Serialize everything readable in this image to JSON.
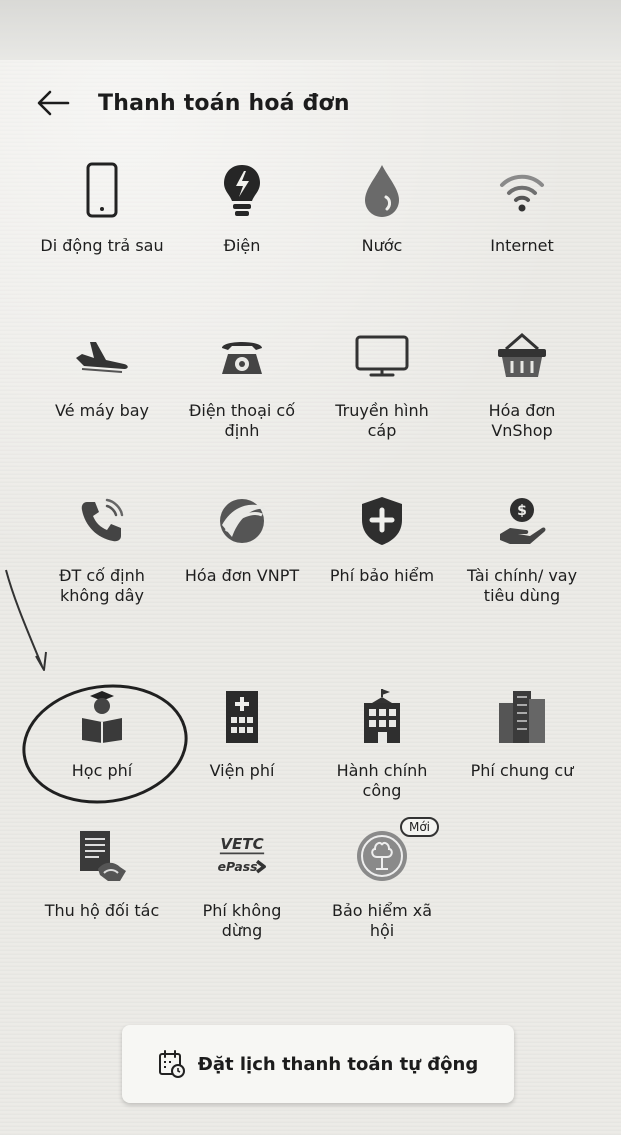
{
  "header": {
    "title": "Thanh toán hoá đơn",
    "back_icon": "arrow-left-icon"
  },
  "services": [
    {
      "id": "di-dong-tra-sau",
      "label": "Di động trả sau",
      "icon": "mobile-phone-icon"
    },
    {
      "id": "dien",
      "label": "Điện",
      "icon": "lightbulb-icon"
    },
    {
      "id": "nuoc",
      "label": "Nước",
      "icon": "water-drop-icon"
    },
    {
      "id": "internet",
      "label": "Internet",
      "icon": "wifi-icon"
    },
    {
      "id": "ve-may-bay",
      "label": "Vé máy bay",
      "icon": "airplane-icon"
    },
    {
      "id": "dien-thoai-co-dinh",
      "label": "Điện thoại cố định",
      "icon": "landline-phone-icon"
    },
    {
      "id": "truyen-hinh-cap",
      "label": "Truyền hình cáp",
      "icon": "tv-icon"
    },
    {
      "id": "hoa-don-vnshop",
      "label": "Hóa đơn VnShop",
      "icon": "shopping-basket-icon"
    },
    {
      "id": "dt-co-dinh-khong-day",
      "label": "ĐT cố định không dây",
      "icon": "phone-wireless-icon"
    },
    {
      "id": "hoa-don-vnpt",
      "label": "Hóa đơn VNPT",
      "icon": "vnpt-logo-icon"
    },
    {
      "id": "phi-bao-hiem",
      "label": "Phí bảo hiểm",
      "icon": "shield-plus-icon"
    },
    {
      "id": "tai-chinh-vay-tieu-dung",
      "label": "Tài chính/ vay tiêu dùng",
      "icon": "hand-coin-icon"
    },
    {
      "id": "hoc-phi",
      "label": "Học phí",
      "icon": "student-book-icon"
    },
    {
      "id": "vien-phi",
      "label": "Viện phí",
      "icon": "hospital-icon"
    },
    {
      "id": "hanh-chinh-cong",
      "label": "Hành chính công",
      "icon": "government-building-icon"
    },
    {
      "id": "phi-chung-cu",
      "label": "Phí chung cư",
      "icon": "apartment-icon"
    },
    {
      "id": "thu-ho-doi-tac",
      "label": "Thu hộ đối tác",
      "icon": "partner-collection-icon"
    },
    {
      "id": "phi-khong-dung",
      "label": "Phí không dừng",
      "icon": "vetc-epass-icon",
      "logo_text_1": "VETC",
      "logo_text_2": "ePass"
    },
    {
      "id": "bao-hiem-xa-hoi",
      "label": "Bảo hiểm xã hội",
      "icon": "social-insurance-icon",
      "badge": "Mới"
    }
  ],
  "schedule_button": {
    "label": "Đặt lịch thanh toán tự động",
    "icon": "calendar-clock-icon"
  }
}
